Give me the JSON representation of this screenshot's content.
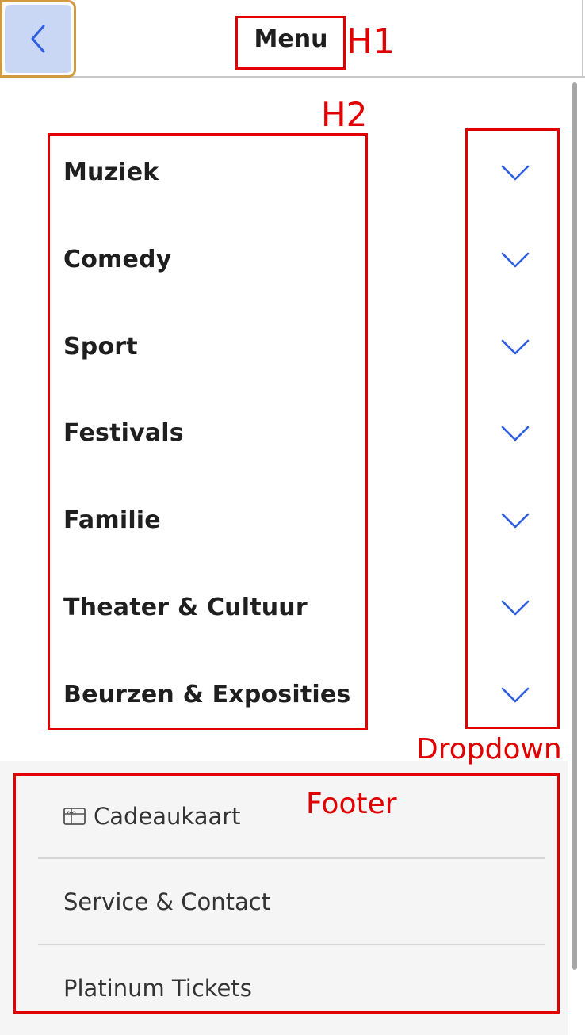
{
  "header": {
    "title": "Menu",
    "back_icon": "chevron-left-icon"
  },
  "categories": [
    {
      "label": "Muziek",
      "icon": "chevron-down-icon"
    },
    {
      "label": "Comedy",
      "icon": "chevron-down-icon"
    },
    {
      "label": "Sport",
      "icon": "chevron-down-icon"
    },
    {
      "label": "Festivals",
      "icon": "chevron-down-icon"
    },
    {
      "label": "Familie",
      "icon": "chevron-down-icon"
    },
    {
      "label": "Theater & Cultuur",
      "icon": "chevron-down-icon"
    },
    {
      "label": "Beurzen & Exposities",
      "icon": "chevron-down-icon"
    }
  ],
  "footer": {
    "links": [
      {
        "label": "Cadeaukaart",
        "icon": "gift-card-icon"
      },
      {
        "label": "Service & Contact"
      },
      {
        "label": "Platinum Tickets"
      }
    ]
  },
  "annotations": {
    "h1": "H1",
    "h2": "H2",
    "dropdown": "Dropdown",
    "footer": "Footer"
  },
  "colors": {
    "accent": "#2f5fe0",
    "annotation": "#e00000",
    "back_button_bg": "#c9d7f5",
    "focus_ring": "#d29a3e",
    "footer_bg": "#f5f5f5"
  }
}
